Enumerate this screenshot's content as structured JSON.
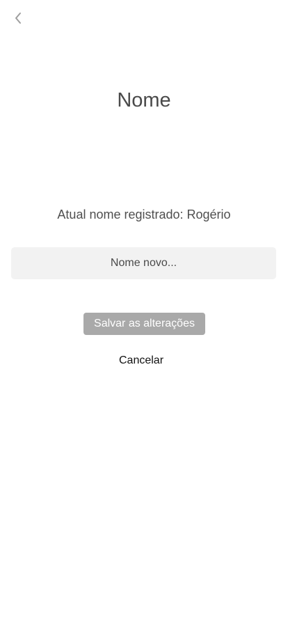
{
  "header": {
    "back_icon": "chevron-left-icon",
    "title": "Nome"
  },
  "main": {
    "current_name_text": "Atual nome registrado: Rogério",
    "new_name_input": {
      "value": "",
      "placeholder": "Nome novo..."
    },
    "save_label": "Salvar as alterações",
    "cancel_label": "Cancelar"
  },
  "colors": {
    "save_button_bg": "#a9a9a9",
    "input_bg": "#f2f2f2",
    "title_text": "#4a4a4a"
  }
}
